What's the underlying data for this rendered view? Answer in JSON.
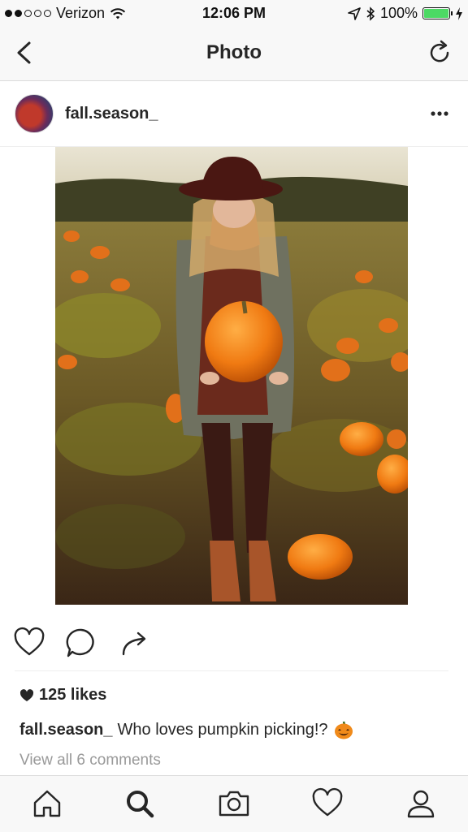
{
  "status_bar": {
    "carrier": "Verizon",
    "time": "12:06 PM",
    "battery": "100%",
    "signal_filled": 2,
    "signal_total": 5
  },
  "nav": {
    "title": "Photo"
  },
  "post": {
    "username": "fall.season_",
    "likes": "125 likes",
    "caption_user": "fall.season_",
    "caption_text": "Who loves pumpkin picking!?",
    "view_comments": "View all 6 comments"
  },
  "icons": {
    "back": "chevron-left-icon",
    "refresh": "refresh-icon",
    "more": "more-options-icon",
    "like": "heart-icon",
    "comment": "comment-icon",
    "share": "share-icon",
    "home": "home-icon",
    "search": "search-icon",
    "camera": "camera-icon",
    "activity": "heart-icon",
    "profile": "profile-icon"
  },
  "colors": {
    "battery": "#4cd964",
    "accent": "#262626",
    "muted": "#999999"
  }
}
